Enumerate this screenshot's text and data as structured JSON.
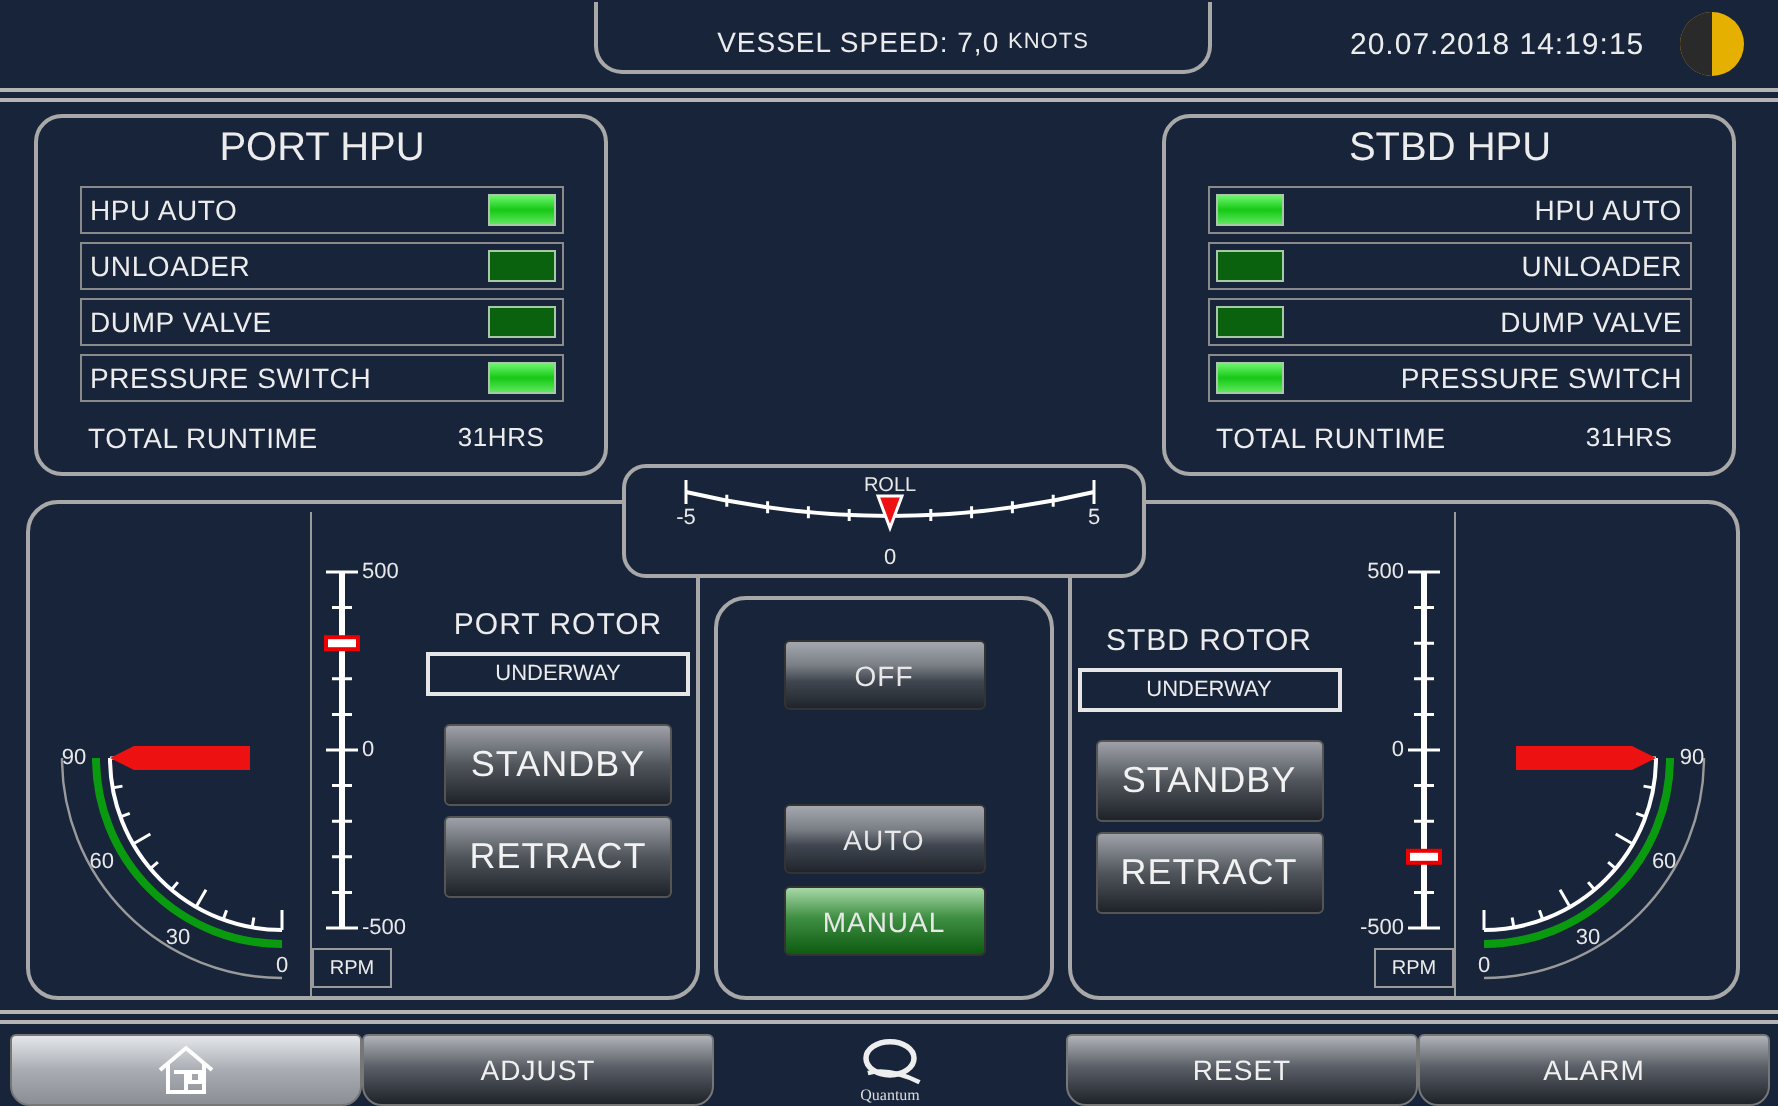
{
  "header": {
    "speed": "VESSEL SPEED: 7,0",
    "speed_unit": "KNOTS",
    "datetime": "20.07.2018 14:19:15"
  },
  "hpus": [
    {
      "kind": "port",
      "title": "PORT HPU",
      "indicators": [
        {
          "label": "HPU AUTO",
          "on": true
        },
        {
          "label": "UNLOADER",
          "on": false
        },
        {
          "label": "DUMP VALVE",
          "on": false
        },
        {
          "label": "PRESSURE SWITCH",
          "on": true
        }
      ],
      "runtime_label": "TOTAL RUNTIME",
      "runtime_value": "31HRS"
    },
    {
      "kind": "stbd",
      "title": "STBD HPU",
      "indicators": [
        {
          "label": "HPU AUTO",
          "on": true
        },
        {
          "label": "UNLOADER",
          "on": false
        },
        {
          "label": "DUMP VALVE",
          "on": false
        },
        {
          "label": "PRESSURE SWITCH",
          "on": true
        }
      ],
      "runtime_label": "TOTAL RUNTIME",
      "runtime_value": "31HRS"
    }
  ],
  "roll": {
    "label": "ROLL",
    "scale": [
      "-5",
      "0",
      "5"
    ],
    "level": 0.5
  },
  "rotors": [
    {
      "kind": "port",
      "title": "PORT ROTOR",
      "status": "UNDERWAY",
      "buttons": [
        "STANDBY",
        "RETRACT"
      ],
      "rpm": {
        "labels": [
          "500",
          "0",
          "-500"
        ],
        "unit": "RPM",
        "level": 0.8
      },
      "angle": {
        "labels": [
          "90",
          "60",
          "30",
          "0"
        ],
        "level": 1
      }
    },
    {
      "kind": "stbd",
      "title": "STBD ROTOR",
      "status": "UNDERWAY",
      "buttons": [
        "STANDBY",
        "RETRACT"
      ],
      "rpm": {
        "labels": [
          "500",
          "0",
          "-500"
        ],
        "unit": "RPM",
        "level": 0.2
      },
      "angle": {
        "labels": [
          "90",
          "60",
          "30",
          "0"
        ],
        "level": 1
      }
    }
  ],
  "modes": [
    {
      "label": "OFF",
      "selected": false
    },
    {
      "label": "AUTO",
      "selected": false
    },
    {
      "label": "MANUAL",
      "selected": true
    }
  ],
  "nav": [
    {
      "kind": "home",
      "selected": true
    },
    {
      "kind": "text",
      "label": "ADJUST",
      "selected": false
    },
    {
      "kind": "logo",
      "label": "Quantum"
    },
    {
      "kind": "text",
      "label": "RESET",
      "selected": false
    },
    {
      "kind": "text",
      "label": "ALARM",
      "selected": false
    }
  ]
}
